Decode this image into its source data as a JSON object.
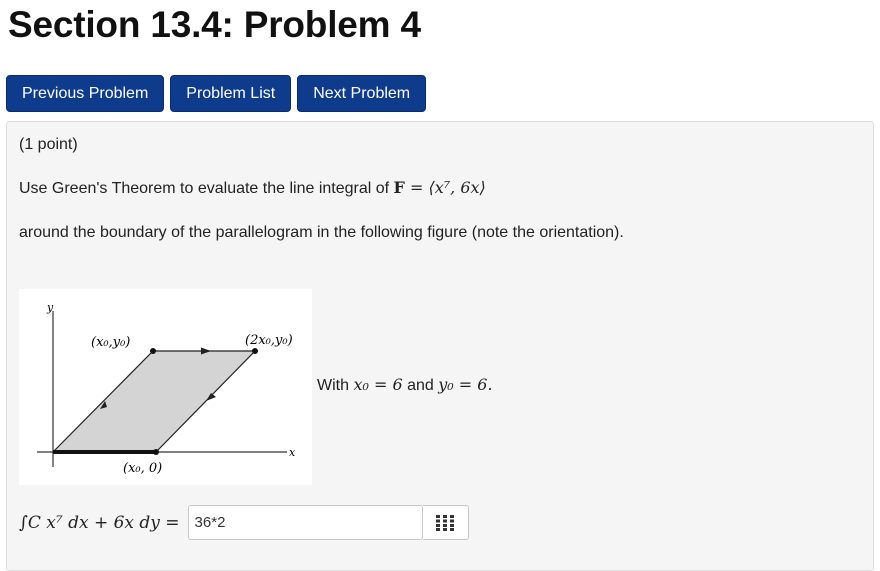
{
  "page": {
    "title": "Section 13.4: Problem 4"
  },
  "nav": {
    "previous_label": "Previous Problem",
    "list_label": "Problem List",
    "next_label": "Next Problem"
  },
  "problem": {
    "points": "(1 point)",
    "statement_prefix": "Use Green's Theorem to evaluate the line integral of ",
    "field_symbol": "F",
    "field_expr": "= ⟨x⁷, 6x⟩",
    "statement_line2": "around the boundary of the parallelogram in the following figure (note the orientation).",
    "figure": {
      "y_axis_label": "y",
      "x_axis_label": "x",
      "top_left_label": "(x₀,y₀)",
      "top_right_label": "(2x₀,y₀)",
      "bottom_label": "(x₀, 0)"
    },
    "with_prefix": "With ",
    "with_x0": "x₀ = 6",
    "with_and": " and ",
    "with_y0": "y₀ = 6.",
    "integral_label": "∫C x⁷ dx + 6x dy =",
    "answer_value": "36*2"
  },
  "colors": {
    "nav_button": "#0f3b8c",
    "panel_bg": "#f5f5f5",
    "parallelogram_fill": "#d4d4d4"
  },
  "icons": {
    "equation_editor": "grid-icon"
  }
}
